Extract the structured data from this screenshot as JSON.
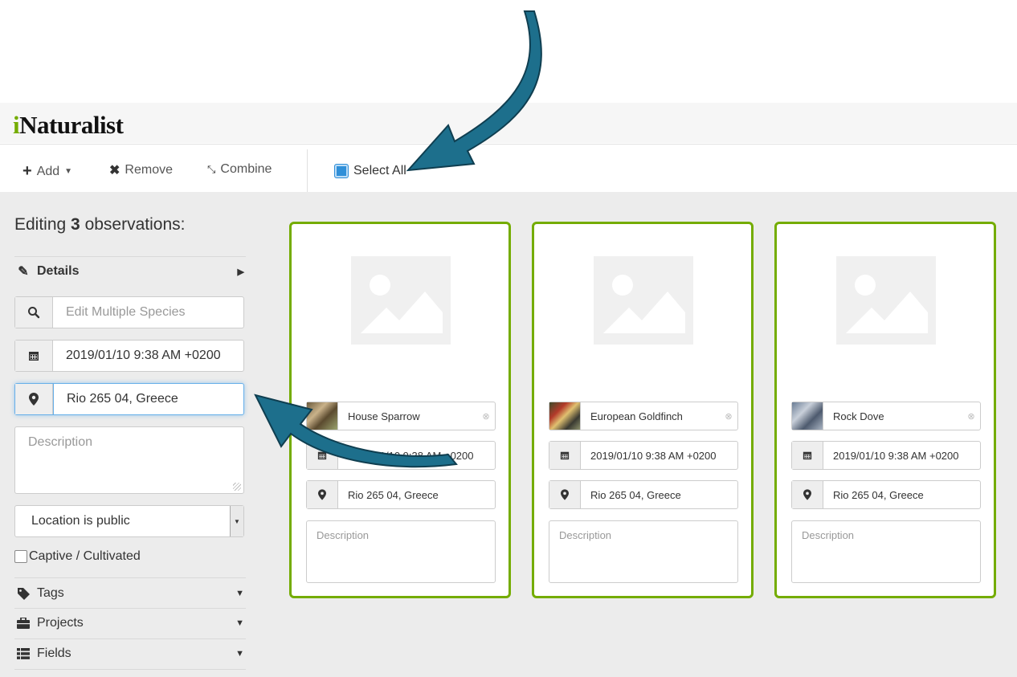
{
  "app": {
    "logo_i": "i",
    "logo_rest": "Naturalist"
  },
  "toolbar": {
    "add_label": "Add",
    "remove_label": "Remove",
    "combine_label": "Combine",
    "select_all_label": "Select All"
  },
  "sidebar": {
    "editing_prefix": "Editing ",
    "editing_count": "3",
    "editing_suffix": " observations:",
    "details_label": "Details",
    "species_placeholder": "Edit Multiple Species",
    "date_value": "2019/01/10 9:38 AM +0200",
    "location_value": "Rio 265 04, Greece",
    "description_placeholder": "Description",
    "geoprivacy_value": "Location is public",
    "captive_label": "Captive / Cultivated",
    "tags_label": "Tags",
    "projects_label": "Projects",
    "fields_label": "Fields"
  },
  "cards": [
    {
      "species": "House Sparrow",
      "date": "2019/01/10 9:38 AM +0200",
      "location": "Rio 265 04, Greece",
      "description_placeholder": "Description"
    },
    {
      "species": "European Goldfinch",
      "date": "2019/01/10 9:38 AM +0200",
      "location": "Rio 265 04, Greece",
      "description_placeholder": "Description"
    },
    {
      "species": "Rock Dove",
      "date": "2019/01/10 9:38 AM +0200",
      "location": "Rio 265 04, Greece",
      "description_placeholder": "Description"
    }
  ],
  "colors": {
    "accent_green": "#74ac00",
    "annotation_arrow": "#1d6f8c",
    "select_all_checkbox": "#2f8fd8"
  }
}
